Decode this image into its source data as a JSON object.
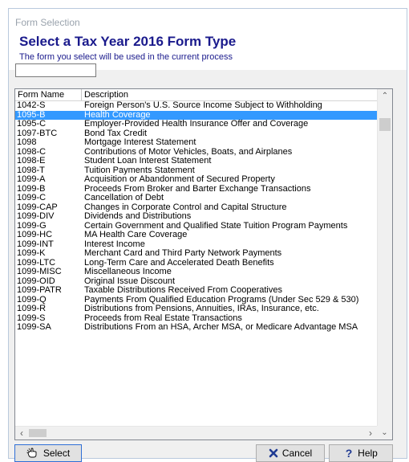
{
  "window": {
    "title": "Form Selection"
  },
  "header": {
    "heading": "Select a Tax Year 2016 Form Type",
    "subtitle": "The form you select will be used in the current process"
  },
  "filter": {
    "value": "",
    "placeholder": ""
  },
  "list": {
    "columns": {
      "name": "Form Name",
      "description": "Description"
    },
    "selected_index": 1,
    "rows": [
      {
        "name": "1042-S",
        "description": "Foreign Person's U.S. Source Income Subject to Withholding"
      },
      {
        "name": "1095-B",
        "description": "Health Coverage"
      },
      {
        "name": "1095-C",
        "description": "Employer-Provided Health Insurance Offer and Coverage"
      },
      {
        "name": "1097-BTC",
        "description": "Bond Tax Credit"
      },
      {
        "name": "1098",
        "description": "Mortgage Interest Statement"
      },
      {
        "name": "1098-C",
        "description": "Contributions of Motor Vehicles, Boats, and Airplanes"
      },
      {
        "name": "1098-E",
        "description": "Student Loan Interest Statement"
      },
      {
        "name": "1098-T",
        "description": "Tuition Payments Statement"
      },
      {
        "name": "1099-A",
        "description": "Acquisition or Abandonment of Secured Property"
      },
      {
        "name": "1099-B",
        "description": "Proceeds From Broker and Barter Exchange Transactions"
      },
      {
        "name": "1099-C",
        "description": "Cancellation of Debt"
      },
      {
        "name": "1099-CAP",
        "description": "Changes in Corporate Control and Capital Structure"
      },
      {
        "name": "1099-DIV",
        "description": "Dividends and Distributions"
      },
      {
        "name": "1099-G",
        "description": "Certain Government and Qualified State Tuition Program Payments"
      },
      {
        "name": "1099-HC",
        "description": "MA Health Care Coverage"
      },
      {
        "name": "1099-INT",
        "description": "Interest Income"
      },
      {
        "name": "1099-K",
        "description": "Merchant Card and Third Party Network Payments"
      },
      {
        "name": "1099-LTC",
        "description": "Long-Term Care and Accelerated Death Benefits"
      },
      {
        "name": "1099-MISC",
        "description": "Miscellaneous Income"
      },
      {
        "name": "1099-OID",
        "description": "Original Issue Discount"
      },
      {
        "name": "1099-PATR",
        "description": "Taxable Distributions Received From Cooperatives"
      },
      {
        "name": "1099-Q",
        "description": "Payments From Qualified Education Programs (Under Sec 529 & 530)"
      },
      {
        "name": "1099-R",
        "description": "Distributions from Pensions, Annuities, IRAs, Insurance, etc."
      },
      {
        "name": "1099-S",
        "description": "Proceeds from Real Estate Transactions"
      },
      {
        "name": "1099-SA",
        "description": "Distributions From an HSA, Archer MSA, or Medicare Advantage MSA"
      }
    ]
  },
  "buttons": {
    "select_label": "Select",
    "cancel_label": "Cancel",
    "help_label": "Help"
  },
  "icons": {
    "select": "hand-pointer-icon",
    "cancel": "x-icon",
    "help": "question-mark-icon"
  },
  "colors": {
    "heading": "#1a1a8c",
    "selection": "#3399ff",
    "cancel_icon": "#1f3a93",
    "help_icon": "#1f3a93"
  }
}
